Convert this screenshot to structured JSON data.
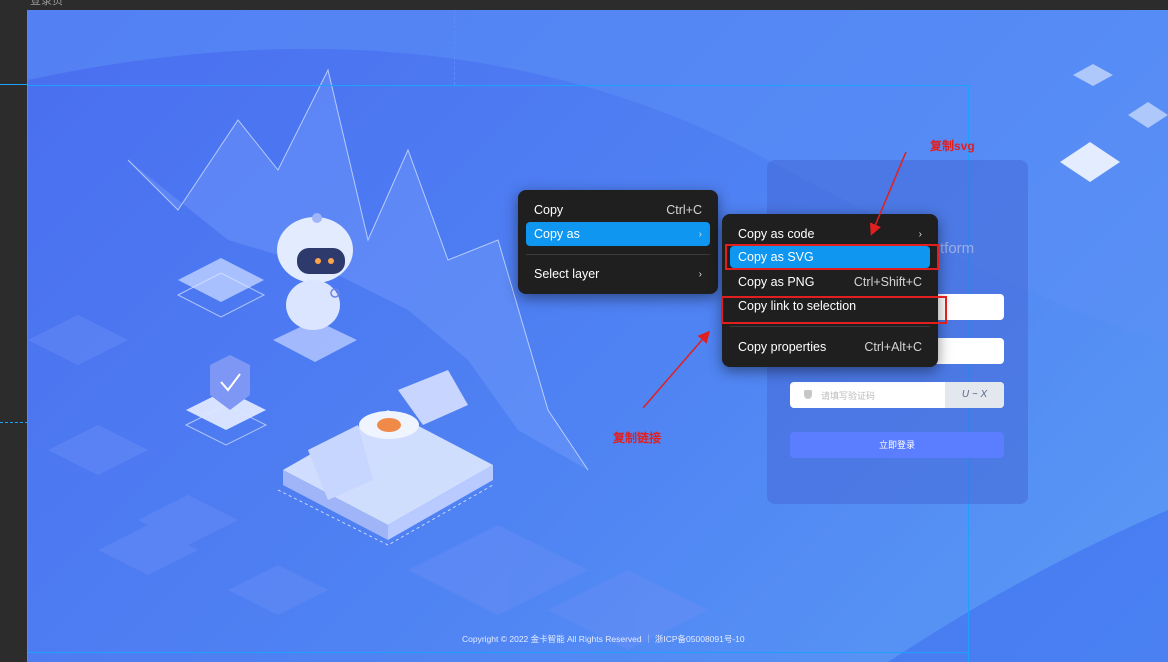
{
  "frame": {
    "label": "登录页"
  },
  "context_menu": {
    "items": [
      {
        "label": "Copy",
        "shortcut": "Ctrl+C"
      },
      {
        "label": "Copy as",
        "submenu_icon": "chevron-right-icon"
      },
      {
        "label": "Select layer",
        "submenu_icon": "chevron-right-icon"
      }
    ]
  },
  "submenu": {
    "items": [
      {
        "label": "Copy as code",
        "submenu_icon": "chevron-right-icon"
      },
      {
        "label": "Copy as SVG"
      },
      {
        "label": "Copy as PNG",
        "shortcut": "Ctrl+Shift+C"
      },
      {
        "label": "Copy link to selection"
      },
      {
        "label": "Copy properties",
        "shortcut": "Ctrl+Alt+C"
      }
    ]
  },
  "login": {
    "brand_partial": "tform",
    "captcha_placeholder": "请填写验证码",
    "captcha_text": "U ~ X",
    "login_button": "立即登录"
  },
  "annotations": {
    "svg_label": "复制svg",
    "link_label": "复制链接"
  },
  "footer": {
    "text": "Copyright © 2022 金卡智能 All Rights Reserved ｜ 浙ICP备05008091号-10"
  },
  "colors": {
    "menu_bg": "#1f1f1f",
    "menu_highlight": "#0e96f0",
    "annotation_red": "#e21f1f",
    "canvas_blue": "#4a6ef0",
    "login_button": "#5b7dff"
  }
}
